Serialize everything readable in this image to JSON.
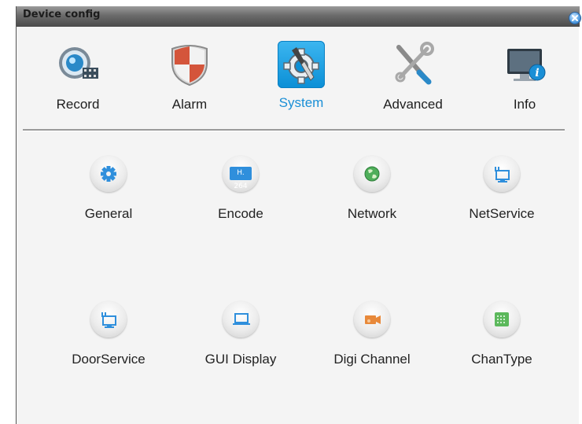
{
  "window": {
    "title": "Device config"
  },
  "tabs": [
    {
      "label": "Record",
      "icon": "record-icon"
    },
    {
      "label": "Alarm",
      "icon": "alarm-shield-icon"
    },
    {
      "label": "System",
      "icon": "system-gear-icon",
      "active": true
    },
    {
      "label": "Advanced",
      "icon": "tools-icon"
    },
    {
      "label": "Info",
      "icon": "info-monitor-icon"
    }
  ],
  "items": [
    {
      "label": "General",
      "icon": "gear-icon"
    },
    {
      "label": "Encode",
      "icon": "h264-icon",
      "badge": "H. 264"
    },
    {
      "label": "Network",
      "icon": "globe-icon"
    },
    {
      "label": "NetService",
      "icon": "net-monitor-icon"
    },
    {
      "label": "DoorService",
      "icon": "door-monitor-icon"
    },
    {
      "label": "GUI Display",
      "icon": "display-icon"
    },
    {
      "label": "Digi Channel",
      "icon": "camera-icon"
    },
    {
      "label": "ChanType",
      "icon": "grid-icon"
    }
  ],
  "colors": {
    "accent": "#1a8fd6",
    "titlebar": "#5a5a5a",
    "icon_blue": "#2f8fdc"
  }
}
